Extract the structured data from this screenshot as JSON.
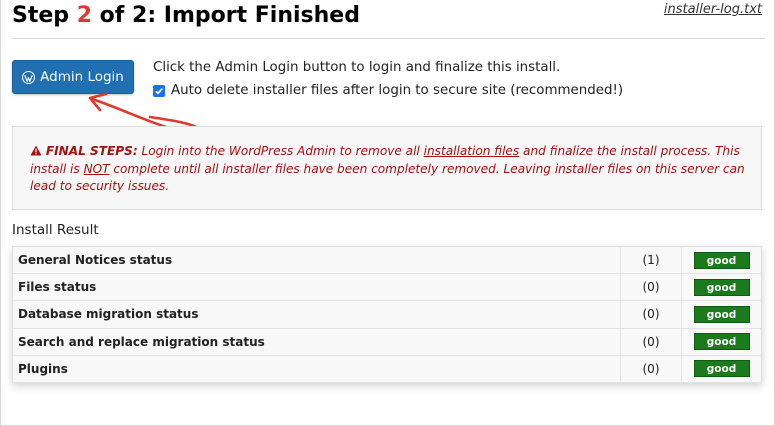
{
  "header": {
    "title_prefix": "Step ",
    "title_step": "2",
    "title_suffix": " of 2: Import Finished",
    "log_link": "installer-log.txt"
  },
  "admin": {
    "button_label": "Admin Login",
    "instruction": "Click the Admin Login button to login and finalize this install.",
    "auto_delete_label": "Auto delete installer files after login to secure site (recommended!)",
    "auto_delete_checked": true
  },
  "notice": {
    "heading": "FINAL STEPS:",
    "text_1": " Login into the WordPress Admin to remove all ",
    "link_text": "installation files",
    "text_2": " and finalize the install process. This install is ",
    "not_text": "NOT",
    "text_3": " complete until all installer files have been completely removed. Leaving installer files on this server can lead to security issues."
  },
  "result": {
    "label": "Install Result",
    "rows": [
      {
        "name": "General Notices status",
        "count": "(1)",
        "status": "good"
      },
      {
        "name": "Files status",
        "count": "(0)",
        "status": "good"
      },
      {
        "name": "Database migration status",
        "count": "(0)",
        "status": "good"
      },
      {
        "name": "Search and replace migration status",
        "count": "(0)",
        "status": "good"
      },
      {
        "name": "Plugins",
        "count": "(0)",
        "status": "good"
      }
    ]
  },
  "colors": {
    "accent_red": "#e3372e",
    "button_blue": "#1f6fb2",
    "notice_text": "#a21212",
    "status_good": "#1b7a1b"
  },
  "icons": [
    "wordpress-icon",
    "warning-icon",
    "checkbox-icon",
    "annotation-arrow"
  ]
}
